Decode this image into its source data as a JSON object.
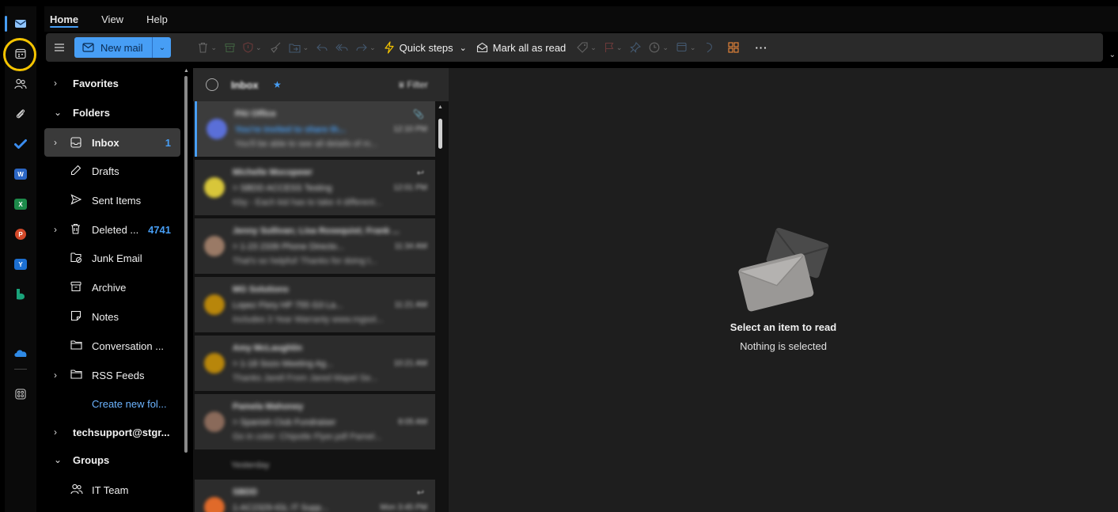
{
  "tabs": [
    {
      "label": "Home",
      "active": true
    },
    {
      "label": "View",
      "active": false
    },
    {
      "label": "Help",
      "active": false
    }
  ],
  "ribbon": {
    "new_mail_label": "New mail",
    "quick_steps_label": "Quick steps",
    "mark_all_read_label": "Mark all as read",
    "more_label": "···"
  },
  "folders": {
    "favorites": "Favorites",
    "folders_header": "Folders",
    "inbox": {
      "label": "Inbox",
      "count": "1"
    },
    "drafts": "Drafts",
    "sent": "Sent Items",
    "deleted": {
      "label": "Deleted ...",
      "count": "4741"
    },
    "junk": "Junk Email",
    "archive": "Archive",
    "notes": "Notes",
    "conversation": "Conversation ...",
    "rss": "RSS Feeds",
    "create_new": "Create new fol...",
    "account": "techsupport@stgr...",
    "groups": "Groups",
    "it_team": "IT Team"
  },
  "message_list": {
    "title": "Inbox",
    "filter_label": "Filter",
    "date_separator": "Yesterday",
    "messages": [
      {
        "sender": "PAI Office",
        "subject": "You're invited to share th...",
        "preview": "You'll be able to see all details of m...",
        "time": "12:10 PM",
        "avatar_color": "#5a6fd8",
        "unread": true,
        "selected": true,
        "icon": "📎"
      },
      {
        "sender": "Michelle Mocopewr",
        "subject": "> SBDD ACCESS Testing",
        "preview": "Kby - Each kid has to take 4 different...",
        "time": "12:01 PM",
        "avatar_color": "#d8c63a",
        "unread": false,
        "selected": false,
        "icon": "↩"
      },
      {
        "sender": "Jenny Sullivan; Lisa Rosequist; Frank ...",
        "subject": "> 1-23 2339 Phone Directo...",
        "preview": "That's so helpful! Thanks for doing t...",
        "time": "11:34 AM",
        "avatar_color": "#9a7a66",
        "unread": false,
        "selected": false,
        "icon": ""
      },
      {
        "sender": "MG Solutions",
        "subject": "Lopez Flory HP 755 G3 La...",
        "preview": "Includes 3 Year Warranty www.mgsol...",
        "time": "11:21 AM",
        "avatar_color": "#b8860b",
        "unread": false,
        "selected": false,
        "icon": ""
      },
      {
        "sender": "Amy McLaughlin",
        "subject": "> 1-18 Sozo Meeting Ag...",
        "preview": "Thanks Jarell From Jared Mapel Se...",
        "time": "10:21 AM",
        "avatar_color": "#b8860b",
        "unread": false,
        "selected": false,
        "icon": ""
      },
      {
        "sender": "Pamela Mahoney",
        "subject": "> Spanish Club Fundraiser",
        "preview": "Go in color: Chipotle Flyer.pdf Pamel...",
        "time": "8:05 AM",
        "avatar_color": "#8a6a5a",
        "unread": false,
        "selected": false,
        "icon": ""
      },
      {
        "sender": "SBDD",
        "subject": "1-AC2329-IGL IT Supp...",
        "preview": "",
        "time": "Mon 3:45 PM",
        "avatar_color": "#e06a2a",
        "unread": false,
        "selected": false,
        "icon": "↩"
      }
    ]
  },
  "reading_pane": {
    "title": "Select an item to read",
    "subtitle": "Nothing is selected"
  },
  "colors": {
    "accent": "#479ef5",
    "highlight_ring": "#f5c400",
    "ribbon_bg": "#2a2a2a",
    "reading_bg": "#1e1e1e"
  },
  "rail_icons": [
    "mail-icon",
    "calendar-icon",
    "people-icon",
    "attachment-icon",
    "todo-icon",
    "word-icon",
    "excel-icon",
    "powerpoint-icon",
    "yammer-icon",
    "bookings-icon",
    "onedrive-icon",
    "more-apps-icon"
  ]
}
